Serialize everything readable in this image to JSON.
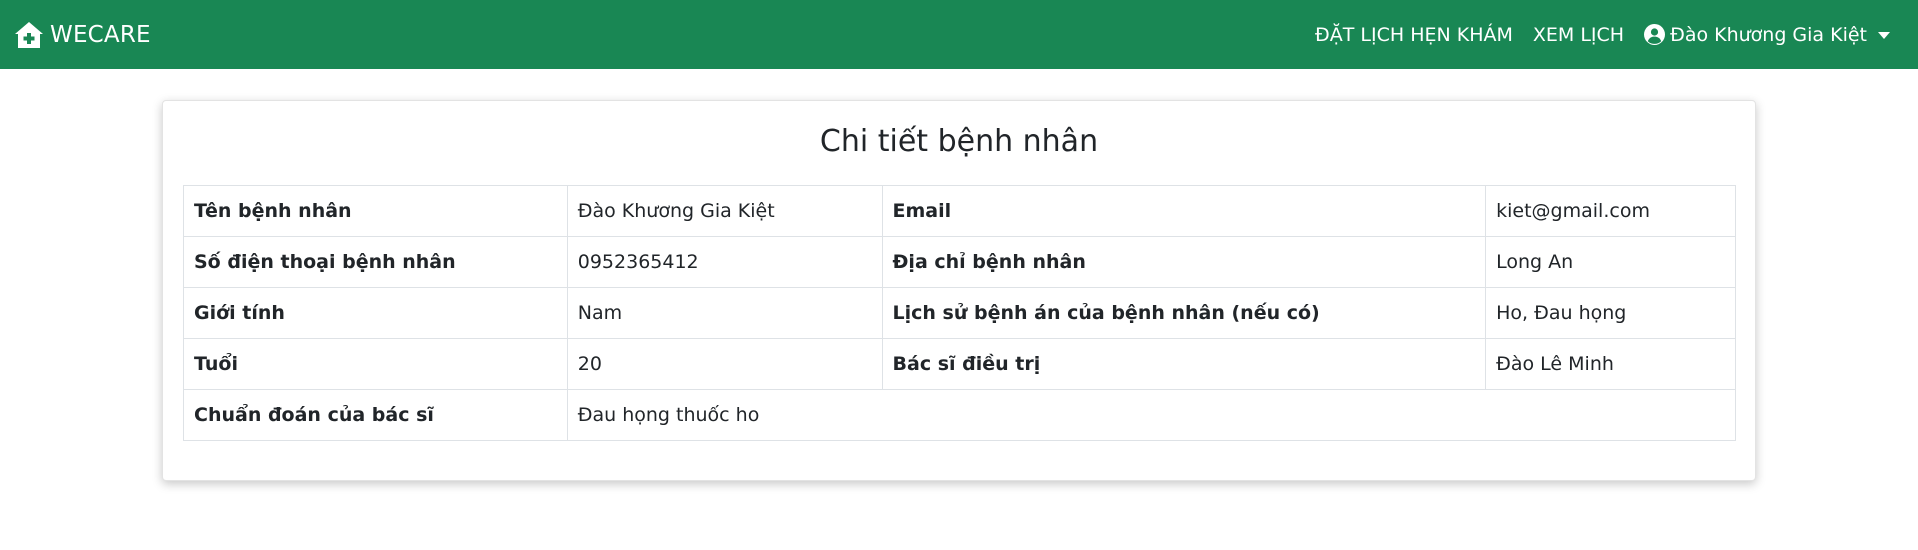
{
  "navbar": {
    "brand": "WECARE",
    "brand_icon": "home-plus-icon",
    "links": [
      "ĐẶT LỊCH HẸN KHÁM",
      "XEM LỊCH"
    ],
    "user_name": "Đào Khương Gia Kiệt",
    "user_icon": "user-circle-icon",
    "bg_color": "#198754"
  },
  "card": {
    "title": "Chi tiết bệnh nhân"
  },
  "patient": {
    "name_label": "Tên bệnh nhân",
    "name_value": "Đào Khương Gia Kiệt",
    "email_label": "Email",
    "email_value": "kiet@gmail.com",
    "phone_label": "Số điện thoại bệnh nhân",
    "phone_value": "0952365412",
    "address_label": "Địa chỉ bệnh nhân",
    "address_value": "Long An",
    "gender_label": "Giới tính",
    "gender_value": "Nam",
    "history_label": "Lịch sử bệnh án của bệnh nhân (nếu có)",
    "history_value": "Ho, Đau họng",
    "age_label": "Tuổi",
    "age_value": "20",
    "doctor_label": "Bác sĩ điều trị",
    "doctor_value": "Đào Lê Minh",
    "diagnosis_label": "Chuẩn đoán của bác sĩ",
    "diagnosis_value": "Đau họng thuốc ho"
  }
}
